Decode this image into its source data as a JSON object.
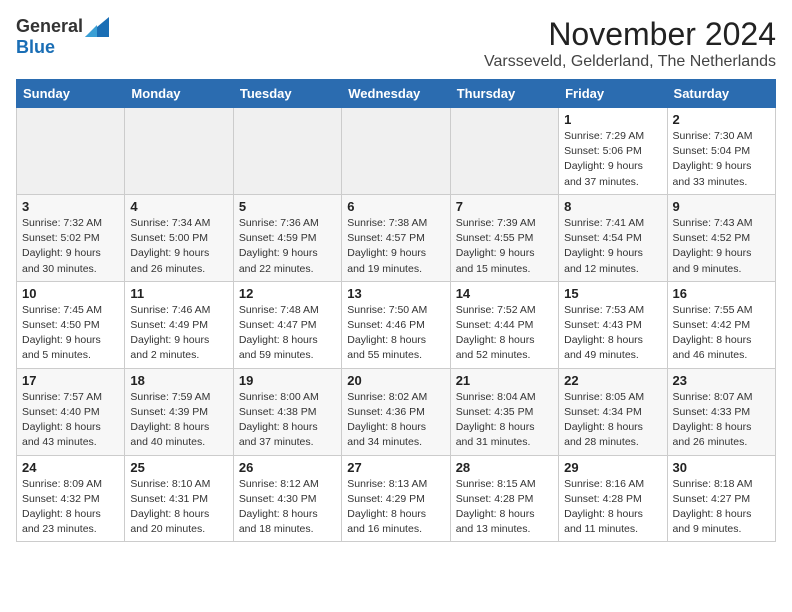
{
  "header": {
    "logo_general": "General",
    "logo_blue": "Blue",
    "month_title": "November 2024",
    "subtitle": "Varsseveld, Gelderland, The Netherlands"
  },
  "days_of_week": [
    "Sunday",
    "Monday",
    "Tuesday",
    "Wednesday",
    "Thursday",
    "Friday",
    "Saturday"
  ],
  "weeks": [
    [
      {
        "day": "",
        "info": "",
        "empty": true
      },
      {
        "day": "",
        "info": "",
        "empty": true
      },
      {
        "day": "",
        "info": "",
        "empty": true
      },
      {
        "day": "",
        "info": "",
        "empty": true
      },
      {
        "day": "",
        "info": "",
        "empty": true
      },
      {
        "day": "1",
        "info": "Sunrise: 7:29 AM\nSunset: 5:06 PM\nDaylight: 9 hours\nand 37 minutes."
      },
      {
        "day": "2",
        "info": "Sunrise: 7:30 AM\nSunset: 5:04 PM\nDaylight: 9 hours\nand 33 minutes."
      }
    ],
    [
      {
        "day": "3",
        "info": "Sunrise: 7:32 AM\nSunset: 5:02 PM\nDaylight: 9 hours\nand 30 minutes."
      },
      {
        "day": "4",
        "info": "Sunrise: 7:34 AM\nSunset: 5:00 PM\nDaylight: 9 hours\nand 26 minutes."
      },
      {
        "day": "5",
        "info": "Sunrise: 7:36 AM\nSunset: 4:59 PM\nDaylight: 9 hours\nand 22 minutes."
      },
      {
        "day": "6",
        "info": "Sunrise: 7:38 AM\nSunset: 4:57 PM\nDaylight: 9 hours\nand 19 minutes."
      },
      {
        "day": "7",
        "info": "Sunrise: 7:39 AM\nSunset: 4:55 PM\nDaylight: 9 hours\nand 15 minutes."
      },
      {
        "day": "8",
        "info": "Sunrise: 7:41 AM\nSunset: 4:54 PM\nDaylight: 9 hours\nand 12 minutes."
      },
      {
        "day": "9",
        "info": "Sunrise: 7:43 AM\nSunset: 4:52 PM\nDaylight: 9 hours\nand 9 minutes."
      }
    ],
    [
      {
        "day": "10",
        "info": "Sunrise: 7:45 AM\nSunset: 4:50 PM\nDaylight: 9 hours\nand 5 minutes."
      },
      {
        "day": "11",
        "info": "Sunrise: 7:46 AM\nSunset: 4:49 PM\nDaylight: 9 hours\nand 2 minutes."
      },
      {
        "day": "12",
        "info": "Sunrise: 7:48 AM\nSunset: 4:47 PM\nDaylight: 8 hours\nand 59 minutes."
      },
      {
        "day": "13",
        "info": "Sunrise: 7:50 AM\nSunset: 4:46 PM\nDaylight: 8 hours\nand 55 minutes."
      },
      {
        "day": "14",
        "info": "Sunrise: 7:52 AM\nSunset: 4:44 PM\nDaylight: 8 hours\nand 52 minutes."
      },
      {
        "day": "15",
        "info": "Sunrise: 7:53 AM\nSunset: 4:43 PM\nDaylight: 8 hours\nand 49 minutes."
      },
      {
        "day": "16",
        "info": "Sunrise: 7:55 AM\nSunset: 4:42 PM\nDaylight: 8 hours\nand 46 minutes."
      }
    ],
    [
      {
        "day": "17",
        "info": "Sunrise: 7:57 AM\nSunset: 4:40 PM\nDaylight: 8 hours\nand 43 minutes."
      },
      {
        "day": "18",
        "info": "Sunrise: 7:59 AM\nSunset: 4:39 PM\nDaylight: 8 hours\nand 40 minutes."
      },
      {
        "day": "19",
        "info": "Sunrise: 8:00 AM\nSunset: 4:38 PM\nDaylight: 8 hours\nand 37 minutes."
      },
      {
        "day": "20",
        "info": "Sunrise: 8:02 AM\nSunset: 4:36 PM\nDaylight: 8 hours\nand 34 minutes."
      },
      {
        "day": "21",
        "info": "Sunrise: 8:04 AM\nSunset: 4:35 PM\nDaylight: 8 hours\nand 31 minutes."
      },
      {
        "day": "22",
        "info": "Sunrise: 8:05 AM\nSunset: 4:34 PM\nDaylight: 8 hours\nand 28 minutes."
      },
      {
        "day": "23",
        "info": "Sunrise: 8:07 AM\nSunset: 4:33 PM\nDaylight: 8 hours\nand 26 minutes."
      }
    ],
    [
      {
        "day": "24",
        "info": "Sunrise: 8:09 AM\nSunset: 4:32 PM\nDaylight: 8 hours\nand 23 minutes."
      },
      {
        "day": "25",
        "info": "Sunrise: 8:10 AM\nSunset: 4:31 PM\nDaylight: 8 hours\nand 20 minutes."
      },
      {
        "day": "26",
        "info": "Sunrise: 8:12 AM\nSunset: 4:30 PM\nDaylight: 8 hours\nand 18 minutes."
      },
      {
        "day": "27",
        "info": "Sunrise: 8:13 AM\nSunset: 4:29 PM\nDaylight: 8 hours\nand 16 minutes."
      },
      {
        "day": "28",
        "info": "Sunrise: 8:15 AM\nSunset: 4:28 PM\nDaylight: 8 hours\nand 13 minutes."
      },
      {
        "day": "29",
        "info": "Sunrise: 8:16 AM\nSunset: 4:28 PM\nDaylight: 8 hours\nand 11 minutes."
      },
      {
        "day": "30",
        "info": "Sunrise: 8:18 AM\nSunset: 4:27 PM\nDaylight: 8 hours\nand 9 minutes."
      }
    ]
  ]
}
